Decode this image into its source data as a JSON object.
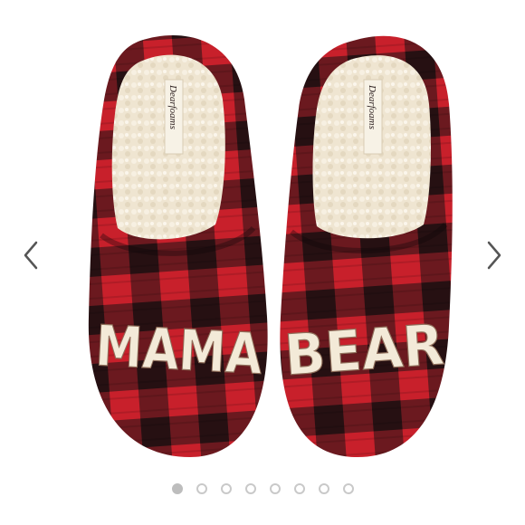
{
  "product_image": {
    "brand_label": "Dearfoams",
    "left_slipper_text": "MAMA",
    "right_slipper_text": "BEAR"
  },
  "carousel": {
    "prev_icon": "chevron-left-icon",
    "next_icon": "chevron-right-icon",
    "slide_count": 8,
    "active_index": 0
  },
  "colors": {
    "plaid_red": "#c8202b",
    "plaid_black": "#1e1416",
    "sherpa_cream": "#f1e8d6",
    "letter_cream": "#f3ead8",
    "dot_active": "#bdbdbd",
    "dot_inactive_border": "#c9c9c9"
  }
}
